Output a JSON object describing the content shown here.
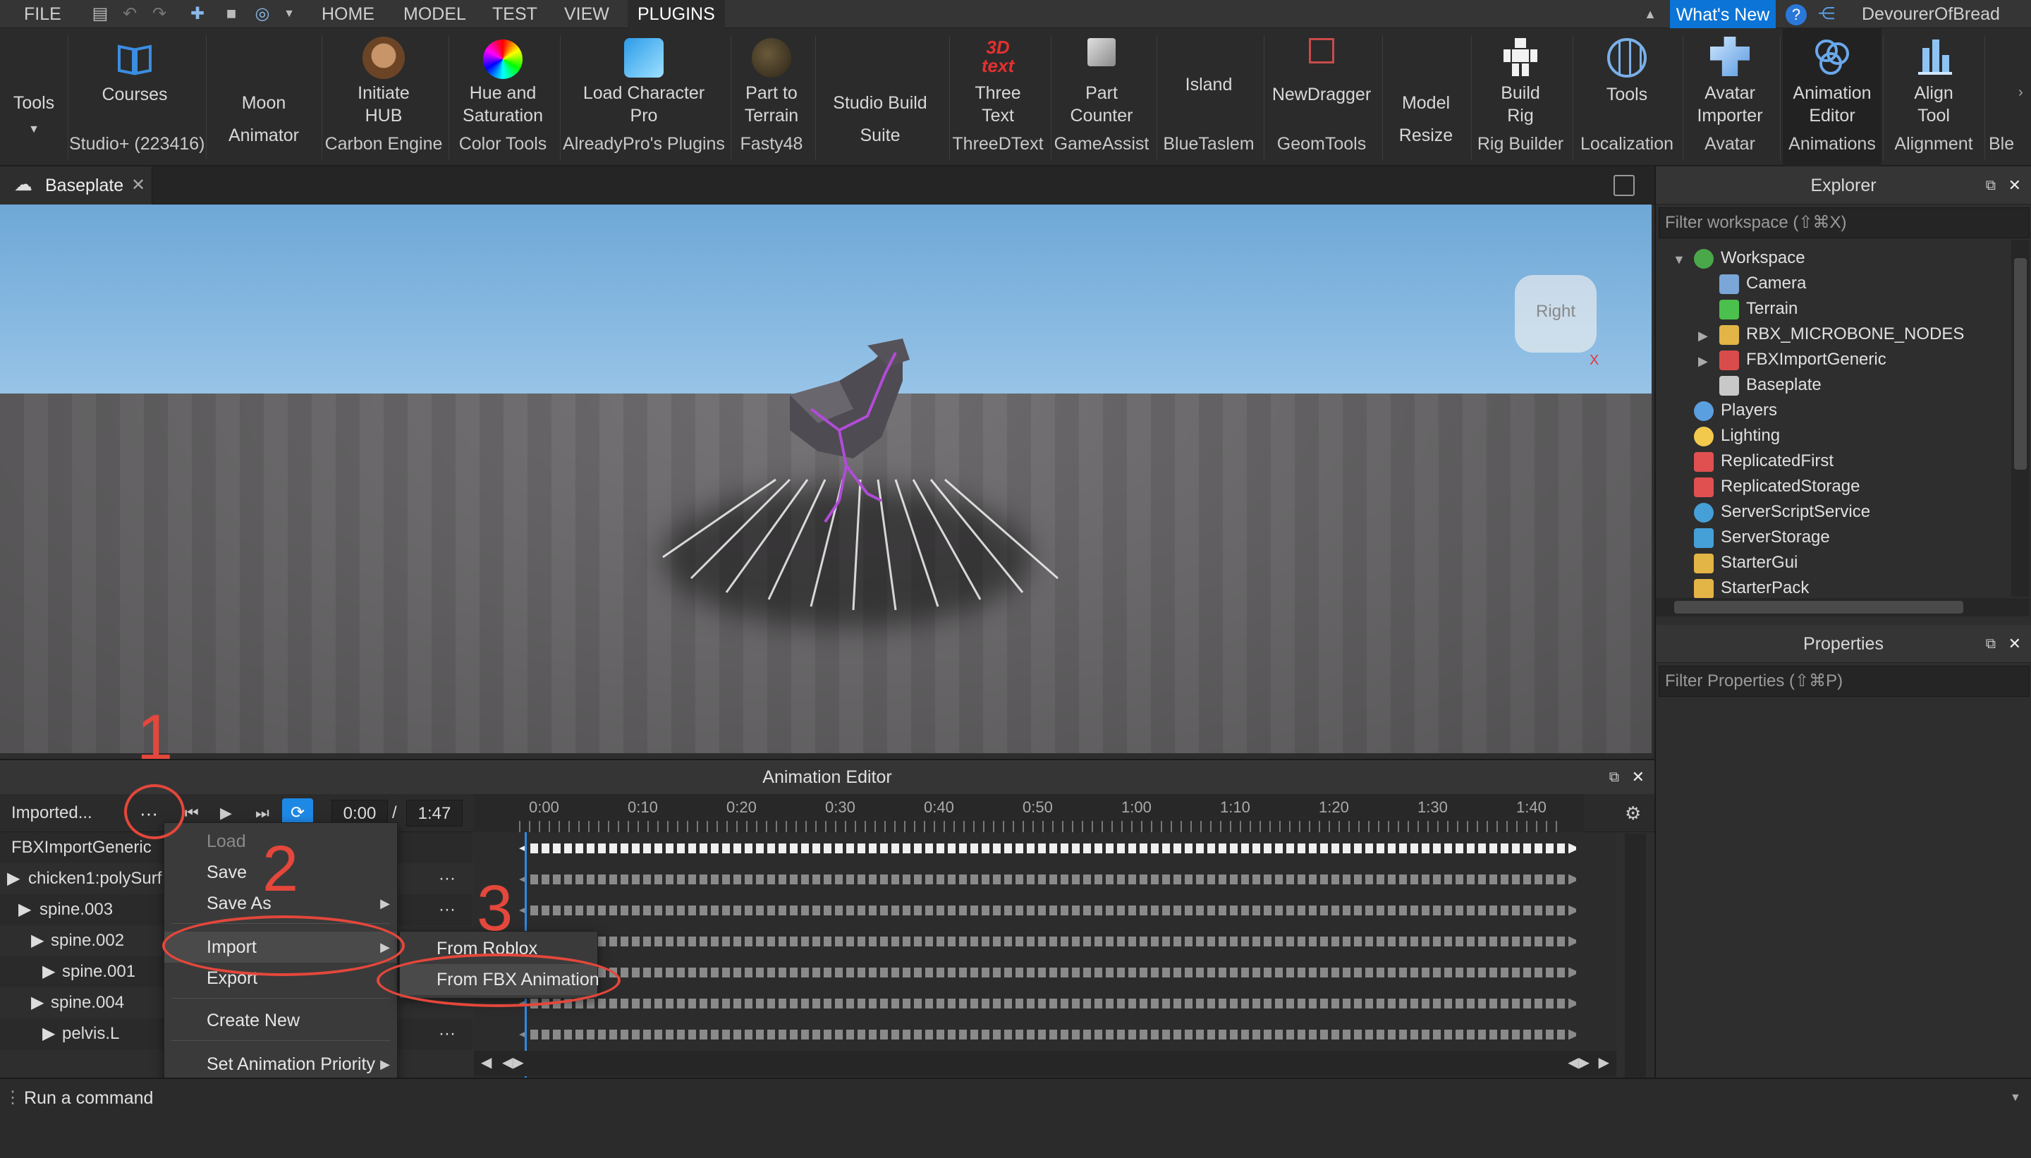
{
  "menubar": {
    "file": "FILE",
    "tabs": [
      "HOME",
      "MODEL",
      "TEST",
      "VIEW",
      "PLUGINS"
    ],
    "active_tab": "PLUGINS",
    "whats_new": "What's New",
    "username": "DevourerOfBread"
  },
  "ribbon": {
    "items": [
      {
        "name": "Tools",
        "group": ""
      },
      {
        "name": "Courses",
        "group": "Studio+ (223416)"
      },
      {
        "name": "Moon",
        "group": "Animator"
      },
      {
        "name": "Initiate HUB",
        "group": "Carbon Engine"
      },
      {
        "name": "Hue and Saturation",
        "group": "Color Tools"
      },
      {
        "name": "Load Character Pro",
        "group": "AlreadyPro's Plugins"
      },
      {
        "name": "Part to Terrain",
        "group": "Fasty48"
      },
      {
        "name": "Studio Build",
        "group": "Suite"
      },
      {
        "name": "Three Text",
        "group": "ThreeDText"
      },
      {
        "name": "Part Counter",
        "group": "GameAssist"
      },
      {
        "name": "Island",
        "group": "BlueTaslem"
      },
      {
        "name": "NewDragger",
        "group": "GeomTools"
      },
      {
        "name": "Model",
        "group": "Resize"
      },
      {
        "name": "Build Rig",
        "group": "Rig Builder"
      },
      {
        "name": "Tools",
        "group": "Localization"
      },
      {
        "name": "Avatar Importer",
        "group": "Avatar"
      },
      {
        "name": "Animation Editor",
        "group": "Animations"
      },
      {
        "name": "Align Tool",
        "group": "Alignment"
      },
      {
        "name": "",
        "group": "Ble"
      }
    ],
    "three_text_icon_label": "3D text"
  },
  "document_tab": {
    "title": "Baseplate"
  },
  "viewport": {
    "view_cube_label": "Right",
    "axis_x": "X"
  },
  "explorer": {
    "title": "Explorer",
    "filter_placeholder": "Filter workspace (⇧⌘X)",
    "items": [
      {
        "label": "Workspace",
        "icon": "globe-icon",
        "color": "#4aa84a"
      },
      {
        "label": "Camera",
        "icon": "camera-icon",
        "color": "#7aa6d8"
      },
      {
        "label": "Terrain",
        "icon": "terrain-icon",
        "color": "#4cc04c"
      },
      {
        "label": "RBX_MICROBONE_NODES",
        "icon": "folder-icon",
        "color": "#e3b446"
      },
      {
        "label": "FBXImportGeneric",
        "icon": "model-icon",
        "color": "#d94c4c"
      },
      {
        "label": "Baseplate",
        "icon": "part-icon",
        "color": "#c8c8c8"
      },
      {
        "label": "Players",
        "icon": "players-icon",
        "color": "#5aa0e0"
      },
      {
        "label": "Lighting",
        "icon": "lightbulb-icon",
        "color": "#f2c94c"
      },
      {
        "label": "ReplicatedFirst",
        "icon": "replicated-icon",
        "color": "#e05050"
      },
      {
        "label": "ReplicatedStorage",
        "icon": "replicated-icon",
        "color": "#e05050"
      },
      {
        "label": "ServerScriptService",
        "icon": "service-icon",
        "color": "#45a0d8"
      },
      {
        "label": "ServerStorage",
        "icon": "storage-icon",
        "color": "#45a0d8"
      },
      {
        "label": "StarterGui",
        "icon": "folder-icon",
        "color": "#e3b446"
      },
      {
        "label": "StarterPack",
        "icon": "folder-icon",
        "color": "#e3b446"
      }
    ]
  },
  "properties": {
    "title": "Properties",
    "filter_placeholder": "Filter Properties (⇧⌘P)"
  },
  "animation_editor": {
    "title": "Animation Editor",
    "anim_name": "Imported...",
    "current_time": "0:00",
    "separator": "/",
    "total_time": "1:47",
    "ticks": [
      "0:00",
      "0:10",
      "0:20",
      "0:30",
      "0:40",
      "0:50",
      "1:00",
      "1:10",
      "1:20",
      "1:30",
      "1:40"
    ],
    "rig": "FBXImportGeneric",
    "tracks": [
      "chicken1:polySurf",
      "spine.003",
      "spine.002",
      "spine.001",
      "spine.004",
      "pelvis.L"
    ]
  },
  "context_menu": {
    "items": [
      "Load",
      "Save",
      "Save As",
      "Import",
      "Export",
      "Create New",
      "Set Animation Priority"
    ]
  },
  "import_submenu": {
    "items": [
      "From Roblox",
      "From FBX Animation"
    ]
  },
  "annotations": [
    "1",
    "2",
    "3"
  ],
  "command_bar": {
    "placeholder": "Run a command"
  }
}
